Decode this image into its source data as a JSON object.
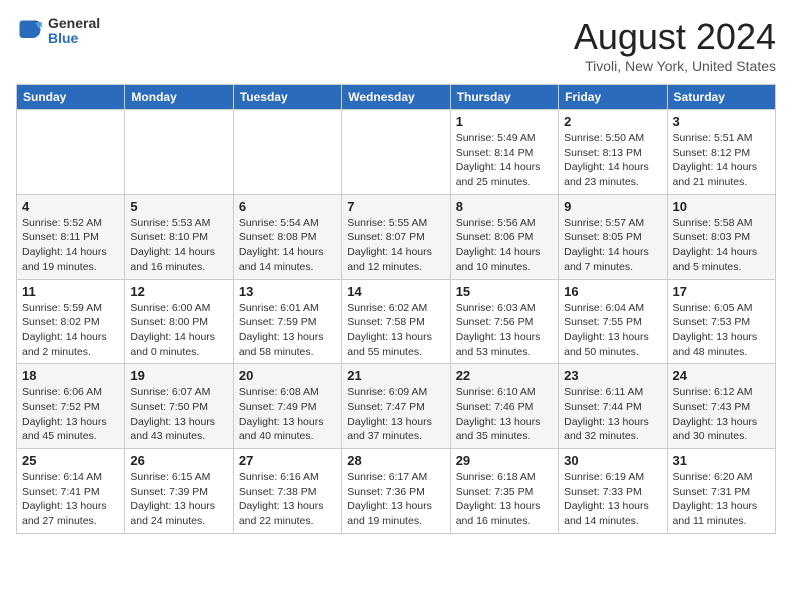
{
  "header": {
    "logo_general": "General",
    "logo_blue": "Blue",
    "month_title": "August 2024",
    "location": "Tivoli, New York, United States"
  },
  "weekdays": [
    "Sunday",
    "Monday",
    "Tuesday",
    "Wednesday",
    "Thursday",
    "Friday",
    "Saturday"
  ],
  "weeks": [
    [
      {
        "day": "",
        "info": ""
      },
      {
        "day": "",
        "info": ""
      },
      {
        "day": "",
        "info": ""
      },
      {
        "day": "",
        "info": ""
      },
      {
        "day": "1",
        "info": "Sunrise: 5:49 AM\nSunset: 8:14 PM\nDaylight: 14 hours\nand 25 minutes."
      },
      {
        "day": "2",
        "info": "Sunrise: 5:50 AM\nSunset: 8:13 PM\nDaylight: 14 hours\nand 23 minutes."
      },
      {
        "day": "3",
        "info": "Sunrise: 5:51 AM\nSunset: 8:12 PM\nDaylight: 14 hours\nand 21 minutes."
      }
    ],
    [
      {
        "day": "4",
        "info": "Sunrise: 5:52 AM\nSunset: 8:11 PM\nDaylight: 14 hours\nand 19 minutes."
      },
      {
        "day": "5",
        "info": "Sunrise: 5:53 AM\nSunset: 8:10 PM\nDaylight: 14 hours\nand 16 minutes."
      },
      {
        "day": "6",
        "info": "Sunrise: 5:54 AM\nSunset: 8:08 PM\nDaylight: 14 hours\nand 14 minutes."
      },
      {
        "day": "7",
        "info": "Sunrise: 5:55 AM\nSunset: 8:07 PM\nDaylight: 14 hours\nand 12 minutes."
      },
      {
        "day": "8",
        "info": "Sunrise: 5:56 AM\nSunset: 8:06 PM\nDaylight: 14 hours\nand 10 minutes."
      },
      {
        "day": "9",
        "info": "Sunrise: 5:57 AM\nSunset: 8:05 PM\nDaylight: 14 hours\nand 7 minutes."
      },
      {
        "day": "10",
        "info": "Sunrise: 5:58 AM\nSunset: 8:03 PM\nDaylight: 14 hours\nand 5 minutes."
      }
    ],
    [
      {
        "day": "11",
        "info": "Sunrise: 5:59 AM\nSunset: 8:02 PM\nDaylight: 14 hours\nand 2 minutes."
      },
      {
        "day": "12",
        "info": "Sunrise: 6:00 AM\nSunset: 8:00 PM\nDaylight: 14 hours\nand 0 minutes."
      },
      {
        "day": "13",
        "info": "Sunrise: 6:01 AM\nSunset: 7:59 PM\nDaylight: 13 hours\nand 58 minutes."
      },
      {
        "day": "14",
        "info": "Sunrise: 6:02 AM\nSunset: 7:58 PM\nDaylight: 13 hours\nand 55 minutes."
      },
      {
        "day": "15",
        "info": "Sunrise: 6:03 AM\nSunset: 7:56 PM\nDaylight: 13 hours\nand 53 minutes."
      },
      {
        "day": "16",
        "info": "Sunrise: 6:04 AM\nSunset: 7:55 PM\nDaylight: 13 hours\nand 50 minutes."
      },
      {
        "day": "17",
        "info": "Sunrise: 6:05 AM\nSunset: 7:53 PM\nDaylight: 13 hours\nand 48 minutes."
      }
    ],
    [
      {
        "day": "18",
        "info": "Sunrise: 6:06 AM\nSunset: 7:52 PM\nDaylight: 13 hours\nand 45 minutes."
      },
      {
        "day": "19",
        "info": "Sunrise: 6:07 AM\nSunset: 7:50 PM\nDaylight: 13 hours\nand 43 minutes."
      },
      {
        "day": "20",
        "info": "Sunrise: 6:08 AM\nSunset: 7:49 PM\nDaylight: 13 hours\nand 40 minutes."
      },
      {
        "day": "21",
        "info": "Sunrise: 6:09 AM\nSunset: 7:47 PM\nDaylight: 13 hours\nand 37 minutes."
      },
      {
        "day": "22",
        "info": "Sunrise: 6:10 AM\nSunset: 7:46 PM\nDaylight: 13 hours\nand 35 minutes."
      },
      {
        "day": "23",
        "info": "Sunrise: 6:11 AM\nSunset: 7:44 PM\nDaylight: 13 hours\nand 32 minutes."
      },
      {
        "day": "24",
        "info": "Sunrise: 6:12 AM\nSunset: 7:43 PM\nDaylight: 13 hours\nand 30 minutes."
      }
    ],
    [
      {
        "day": "25",
        "info": "Sunrise: 6:14 AM\nSunset: 7:41 PM\nDaylight: 13 hours\nand 27 minutes."
      },
      {
        "day": "26",
        "info": "Sunrise: 6:15 AM\nSunset: 7:39 PM\nDaylight: 13 hours\nand 24 minutes."
      },
      {
        "day": "27",
        "info": "Sunrise: 6:16 AM\nSunset: 7:38 PM\nDaylight: 13 hours\nand 22 minutes."
      },
      {
        "day": "28",
        "info": "Sunrise: 6:17 AM\nSunset: 7:36 PM\nDaylight: 13 hours\nand 19 minutes."
      },
      {
        "day": "29",
        "info": "Sunrise: 6:18 AM\nSunset: 7:35 PM\nDaylight: 13 hours\nand 16 minutes."
      },
      {
        "day": "30",
        "info": "Sunrise: 6:19 AM\nSunset: 7:33 PM\nDaylight: 13 hours\nand 14 minutes."
      },
      {
        "day": "31",
        "info": "Sunrise: 6:20 AM\nSunset: 7:31 PM\nDaylight: 13 hours\nand 11 minutes."
      }
    ]
  ]
}
